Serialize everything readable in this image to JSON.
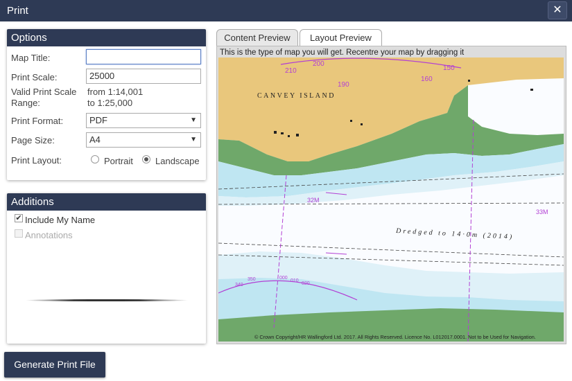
{
  "dialog": {
    "title": "Print",
    "close_glyph": "✕"
  },
  "options": {
    "heading": "Options",
    "map_title_label": "Map Title:",
    "map_title_value": "",
    "print_scale_label": "Print Scale:",
    "print_scale_value": "25000",
    "valid_range_label_1": "Valid Print Scale",
    "valid_range_label_2": "Range:",
    "valid_range_from": "from 1:14,001",
    "valid_range_to": "to 1:25,000",
    "print_format_label": "Print Format:",
    "print_format_value": "PDF",
    "page_size_label": "Page Size:",
    "page_size_value": "A4",
    "print_layout_label": "Print Layout:",
    "portrait_label": "Portrait",
    "landscape_label": "Landscape",
    "selected_layout": "Landscape"
  },
  "additions": {
    "heading": "Additions",
    "include_name_label": "Include My Name",
    "include_name_checked": true,
    "annotations_label": "Annotations",
    "annotations_checked": false
  },
  "preview": {
    "tabs": [
      {
        "label": "Content Preview",
        "active": false
      },
      {
        "label": "Layout Preview",
        "active": true
      }
    ],
    "hint": "This is the type of map you will get. Recentre your map by dragging it",
    "map": {
      "island_label": "CANVEY ISLAND",
      "dredged_label": "Dredged to 14·0m (2014)",
      "bearing_32": "32M",
      "bearing_33": "33M",
      "compass_labels": [
        "210",
        "200",
        "190",
        "160",
        "150"
      ],
      "compass2_labels": [
        "340",
        "350",
        "000",
        "010",
        "020"
      ],
      "copyright": "© Crown Copyright/HR Wallingford Ltd. 2017. All Rights Reserved. Licence No. L012017.0001. Not to be Used for Navigation.",
      "colors": {
        "land": "#e9c77c",
        "green": "#6fa86a",
        "shallow": "#bfe6f2",
        "mid": "#dff1f8",
        "deep": "#fafcff",
        "magenta": "#b23fd4"
      }
    }
  },
  "actions": {
    "generate_label": "Generate Print File"
  }
}
